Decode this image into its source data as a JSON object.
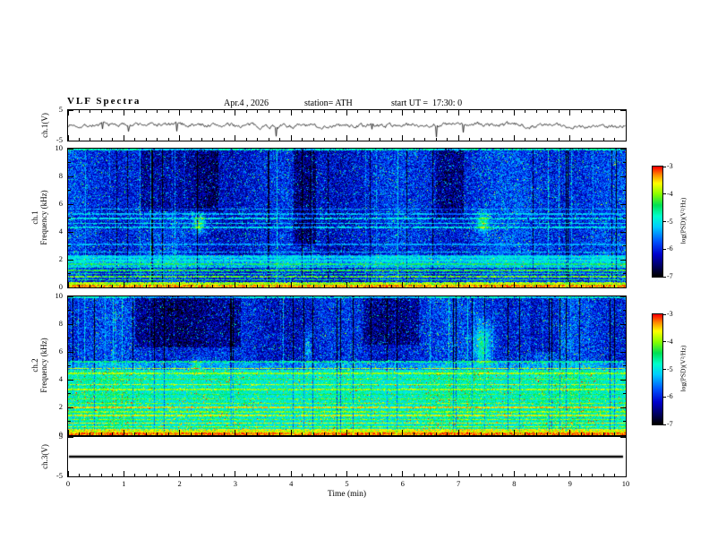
{
  "header": {
    "title": "VLF Spectra",
    "date": "Apr.4 , 2026",
    "station": "station= ATH",
    "start_ut": "start UT =  17:30: 0"
  },
  "xaxis": {
    "label": "Time (min)",
    "min": 0,
    "max": 10,
    "major_ticks": [
      0,
      1,
      2,
      3,
      4,
      5,
      6,
      7,
      8,
      9,
      10
    ],
    "minor_step": 0.2
  },
  "colorbar": {
    "label": "log(PSD)(V²/Hz)",
    "min": -7,
    "max": -3,
    "ticks": [
      -3,
      -4,
      -5,
      -6,
      -7
    ]
  },
  "colormap": {
    "stops": [
      {
        "t": 0.0,
        "c": "#000000"
      },
      {
        "t": 0.08,
        "c": "#000055"
      },
      {
        "t": 0.2,
        "c": "#0000cc"
      },
      {
        "t": 0.32,
        "c": "#0055ff"
      },
      {
        "t": 0.45,
        "c": "#00ccff"
      },
      {
        "t": 0.55,
        "c": "#00ffcc"
      },
      {
        "t": 0.65,
        "c": "#00e055"
      },
      {
        "t": 0.75,
        "c": "#88ff00"
      },
      {
        "t": 0.85,
        "c": "#ffff00"
      },
      {
        "t": 0.93,
        "c": "#ff8800"
      },
      {
        "t": 1.0,
        "c": "#ff0000"
      }
    ]
  },
  "chart_data": [
    {
      "id": "ch1_waveform",
      "type": "line",
      "ylabel": "ch.1(V)",
      "ylim": [
        -5,
        5
      ],
      "yticks": [
        5,
        -5
      ],
      "x_range_minutes": [
        0,
        10
      ],
      "description": "Noisy broadband voltage trace centered on 0 V with occasional spikes to about ±3 V",
      "signal": {
        "baseline": 0,
        "noise_amplitude": 0.9,
        "spike_amplitude": 2.6,
        "spike_probability": 0.012,
        "seed": 7
      }
    },
    {
      "id": "ch1_spectrogram",
      "type": "heatmap",
      "ylabel_lines": [
        "ch.1",
        "Frequency (kHz)"
      ],
      "ylim": [
        0,
        10
      ],
      "yticks": [
        0,
        2,
        4,
        6,
        8,
        10
      ],
      "yticks_minor": [
        1,
        3,
        5,
        7,
        9
      ],
      "value_range": [
        -7,
        -3
      ],
      "seed": 21,
      "bands": [
        {
          "f0": 0,
          "f1": 0.3,
          "v": -3.9,
          "noise": 0.45,
          "sparkle": 0.0,
          "colscale": 0.3
        },
        {
          "f0": 0.3,
          "f1": 1.5,
          "v": -5.9,
          "noise": 0.5,
          "sparkle": 0.03,
          "colscale": 0.8
        },
        {
          "f0": 1.5,
          "f1": 2.35,
          "v": -5.25,
          "noise": 0.45,
          "sparkle": 0.03,
          "colscale": 0.7
        },
        {
          "f0": 2.35,
          "f1": 10,
          "v": -6.0,
          "noise": 0.55,
          "sparkle": 0.05,
          "colscale": 1.0
        }
      ],
      "lines": [
        {
          "f": 0.1,
          "v": -3.3,
          "w": 0.14
        },
        {
          "f": 0.32,
          "v": -3.9,
          "w": 0.1
        },
        {
          "f": 0.55,
          "v": -4.4,
          "w": 0.1
        },
        {
          "f": 0.78,
          "v": -4.1,
          "w": 0.1
        },
        {
          "f": 1.0,
          "v": -4.5,
          "w": 0.09
        },
        {
          "f": 1.22,
          "v": -4.3,
          "w": 0.09
        },
        {
          "f": 1.45,
          "v": -4.7,
          "w": 0.09
        },
        {
          "f": 1.68,
          "v": -4.4,
          "w": 0.09
        },
        {
          "f": 1.92,
          "v": -4.9,
          "w": 0.1
        },
        {
          "f": 2.18,
          "v": -5.0,
          "w": 0.1
        },
        {
          "f": 2.55,
          "v": -5.2,
          "w": 0.09
        },
        {
          "f": 3.1,
          "v": -5.35,
          "w": 0.09
        },
        {
          "f": 4.3,
          "v": -5.0,
          "w": 0.11
        },
        {
          "f": 4.62,
          "v": -5.05,
          "w": 0.11
        },
        {
          "f": 4.95,
          "v": -5.0,
          "w": 0.12
        },
        {
          "f": 5.3,
          "v": -5.2,
          "w": 0.1
        },
        {
          "f": 5.65,
          "v": -5.35,
          "w": 0.09
        },
        {
          "f": 9.93,
          "v": -4.7,
          "w": 0.14
        }
      ],
      "vertical_streaks": {
        "dark_prob": 0.045,
        "dark_depth": 1.25,
        "bright_prob": 0.03,
        "bright_gain": 0.6
      },
      "blobs": [
        {
          "t": 2.35,
          "f": 4.6,
          "amp": 1.5,
          "st": 0.07,
          "sf": 0.45
        },
        {
          "t": 7.45,
          "f": 4.6,
          "amp": 1.3,
          "st": 0.08,
          "sf": 0.5
        }
      ],
      "patches": [
        {
          "t0": 1.3,
          "t1": 2.7,
          "f0": 5.5,
          "f1": 10,
          "dv": -0.45
        },
        {
          "t0": 6.6,
          "t1": 7.1,
          "f0": 5,
          "f1": 10,
          "dv": -0.4
        },
        {
          "t0": 4.05,
          "t1": 4.45,
          "f0": 3,
          "f1": 10,
          "dv": -0.5
        }
      ]
    },
    {
      "id": "ch2_spectrogram",
      "type": "heatmap",
      "ylabel_lines": [
        "ch.2",
        "Frequency (kHz)"
      ],
      "ylim": [
        0,
        10
      ],
      "yticks": [
        0,
        2,
        4,
        6,
        8,
        10
      ],
      "yticks_minor": [
        1,
        3,
        5,
        7,
        9
      ],
      "value_range": [
        -7,
        -3
      ],
      "seed": 43,
      "bands": [
        {
          "f0": 0,
          "f1": 0.3,
          "v": -3.7,
          "noise": 0.4,
          "sparkle": 0.0,
          "colscale": 0.3
        },
        {
          "f0": 0.3,
          "f1": 4.7,
          "v": -4.8,
          "noise": 0.38,
          "sparkle": 0.05,
          "colscale": 0.5
        },
        {
          "f0": 4.7,
          "f1": 5.3,
          "v": -5.4,
          "noise": 0.5,
          "sparkle": 0.04,
          "colscale": 0.8
        },
        {
          "f0": 5.3,
          "f1": 10,
          "v": -6.0,
          "noise": 0.55,
          "sparkle": 0.05,
          "colscale": 1.0
        }
      ],
      "lines": [
        {
          "f": 0.1,
          "v": -3.2,
          "w": 0.16
        },
        {
          "f": 0.38,
          "v": -3.6,
          "w": 0.11
        },
        {
          "f": 0.62,
          "v": -3.9,
          "w": 0.1
        },
        {
          "f": 0.88,
          "v": -3.6,
          "w": 0.11
        },
        {
          "f": 1.12,
          "v": -4.0,
          "w": 0.09
        },
        {
          "f": 1.4,
          "v": -3.7,
          "w": 0.11
        },
        {
          "f": 1.68,
          "v": -4.0,
          "w": 0.09
        },
        {
          "f": 1.98,
          "v": -3.5,
          "w": 0.12
        },
        {
          "f": 2.28,
          "v": -4.0,
          "w": 0.09
        },
        {
          "f": 2.6,
          "v": -4.1,
          "w": 0.09
        },
        {
          "f": 2.95,
          "v": -4.3,
          "w": 0.09
        },
        {
          "f": 3.3,
          "v": -3.9,
          "w": 0.1
        },
        {
          "f": 3.65,
          "v": -3.8,
          "w": 0.11
        },
        {
          "f": 4.05,
          "v": -4.2,
          "w": 0.09
        },
        {
          "f": 4.45,
          "v": -3.9,
          "w": 0.1
        },
        {
          "f": 4.8,
          "v": -3.75,
          "w": 0.1
        },
        {
          "f": 5.3,
          "v": -4.6,
          "w": 0.09
        },
        {
          "f": 9.93,
          "v": -4.85,
          "w": 0.14
        }
      ],
      "vertical_streaks": {
        "dark_prob": 0.055,
        "dark_depth": 1.3,
        "bright_prob": 0.025,
        "bright_gain": 0.55
      },
      "blobs": [
        {
          "t": 7.45,
          "f": 6.5,
          "amp": 1.35,
          "st": 0.1,
          "sf": 1.1
        },
        {
          "t": 2.3,
          "f": 5.0,
          "amp": 0.8,
          "st": 0.06,
          "sf": 0.4
        },
        {
          "t": 4.3,
          "f": 6.2,
          "amp": 0.7,
          "st": 0.05,
          "sf": 0.9
        }
      ],
      "patches": [
        {
          "t0": 1.2,
          "t1": 3.1,
          "f0": 6.3,
          "f1": 10,
          "dv": -0.5
        },
        {
          "t0": 5.3,
          "t1": 6.3,
          "f0": 6.5,
          "f1": 10,
          "dv": -0.35
        },
        {
          "t0": 8.3,
          "t1": 8.8,
          "f0": 6,
          "f1": 10,
          "dv": -0.3
        }
      ]
    },
    {
      "id": "ch3_waveform",
      "type": "line",
      "ylabel": "ch.3(V)",
      "ylim": [
        -5,
        5
      ],
      "yticks": [
        5,
        -5
      ],
      "x_range_minutes": [
        0,
        10
      ],
      "description": "Flat (clipped/constant) trace at 0 V for the whole interval",
      "constant_value": 0,
      "line_width": 2.6
    }
  ]
}
